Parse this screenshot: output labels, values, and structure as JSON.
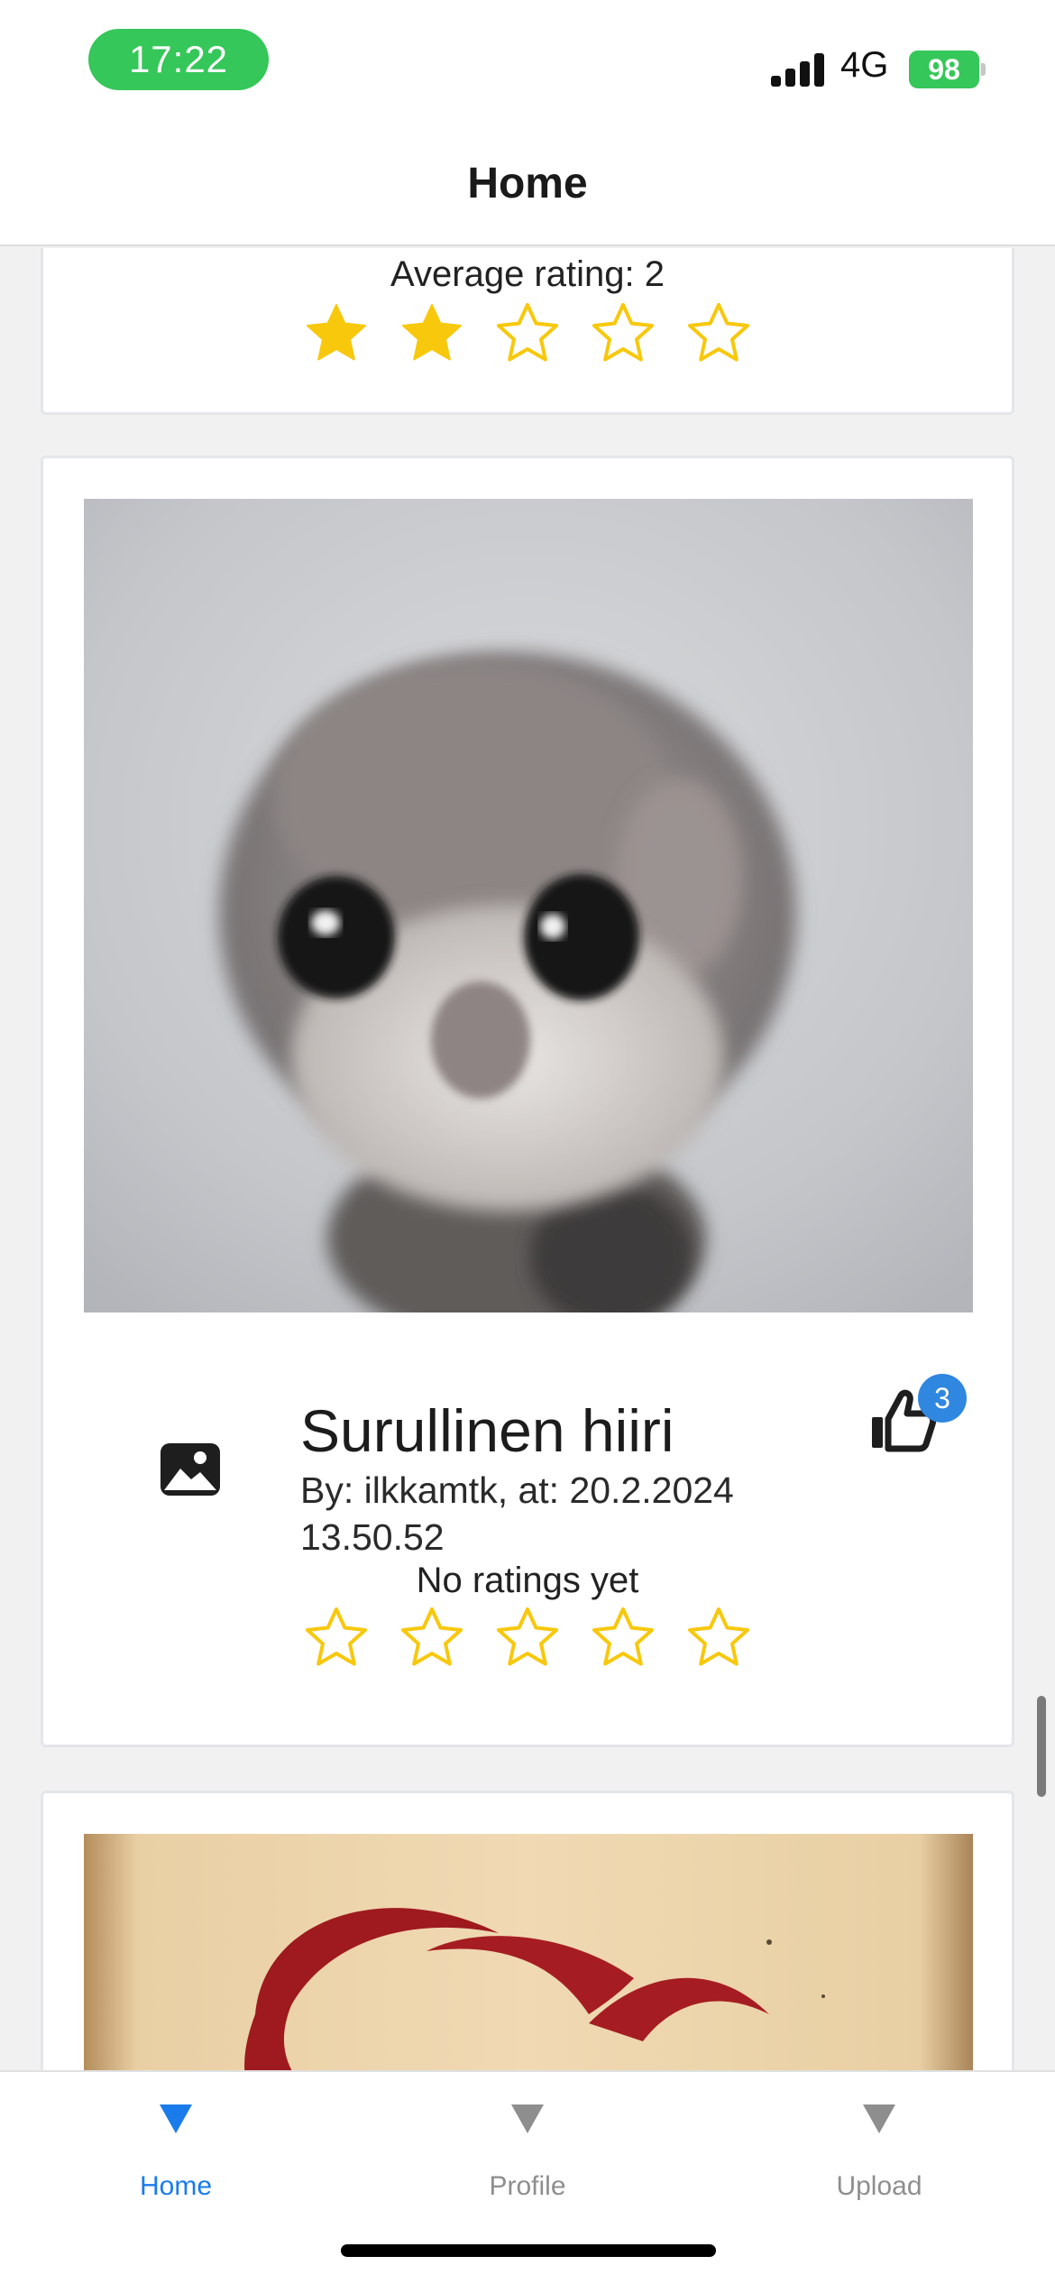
{
  "status_bar": {
    "time": "17:22",
    "network": "4G",
    "battery": "98"
  },
  "header": {
    "title": "Home"
  },
  "feed": {
    "cards": [
      {
        "rating_text": "Average rating: 2",
        "rating_value": 2,
        "max_rating": 5
      },
      {
        "title": "Surullinen hiiri",
        "meta": "By: ilkkamtk, at: 20.2.2024 13.50.52",
        "likes": "3",
        "rating_text": "No ratings yet",
        "rating_value": 0,
        "max_rating": 5,
        "media_icon": "image-icon",
        "like_icon": "thumbs-up-icon"
      },
      {
        "media": "red brush stroke artwork on parchment"
      }
    ]
  },
  "colors": {
    "star": "#f7c80c",
    "active_tab": "#1a7bea",
    "inactive_tab": "#8e8e8e",
    "badge": "#2f87e0",
    "status_green": "#35c759"
  },
  "tabs": [
    {
      "label": "Home",
      "active": true,
      "icon": "triangle-down-icon"
    },
    {
      "label": "Profile",
      "active": false,
      "icon": "triangle-down-icon"
    },
    {
      "label": "Upload",
      "active": false,
      "icon": "triangle-down-icon"
    }
  ]
}
